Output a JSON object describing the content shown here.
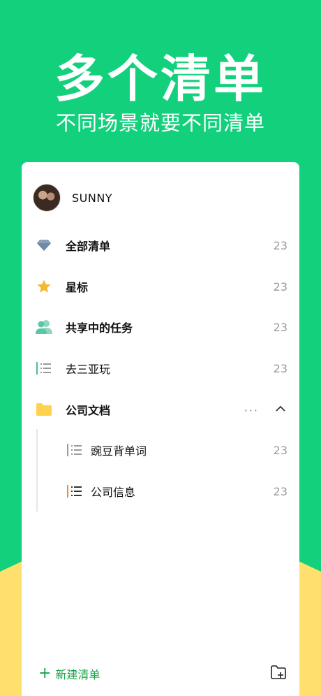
{
  "hero": {
    "title": "多个清单",
    "subtitle": "不同场景就要不同清单"
  },
  "profile": {
    "name": "SUNNY"
  },
  "lists": [
    {
      "label": "全部清单",
      "count": "23",
      "icon": "diamond-icon"
    },
    {
      "label": "星标",
      "count": "23",
      "icon": "star-icon"
    },
    {
      "label": "共享中的任务",
      "count": "23",
      "icon": "shared-users-icon"
    },
    {
      "label": "去三亚玩",
      "count": "23",
      "icon": "list-icon"
    },
    {
      "label": "公司文档",
      "icon": "folder-icon"
    }
  ],
  "sub_lists": [
    {
      "label": "豌豆背单词",
      "count": "23",
      "icon": "list-icon"
    },
    {
      "label": "公司信息",
      "count": "23",
      "icon": "list-icon-orange"
    }
  ],
  "footer": {
    "new_list_label": "新建清单",
    "new_list_icon": "plus-icon",
    "folder_add_icon": "folder-add-icon"
  },
  "colors": {
    "background": "#12D07C",
    "accent_yellow": "#FFE06E",
    "green_text": "#1AA34A"
  }
}
